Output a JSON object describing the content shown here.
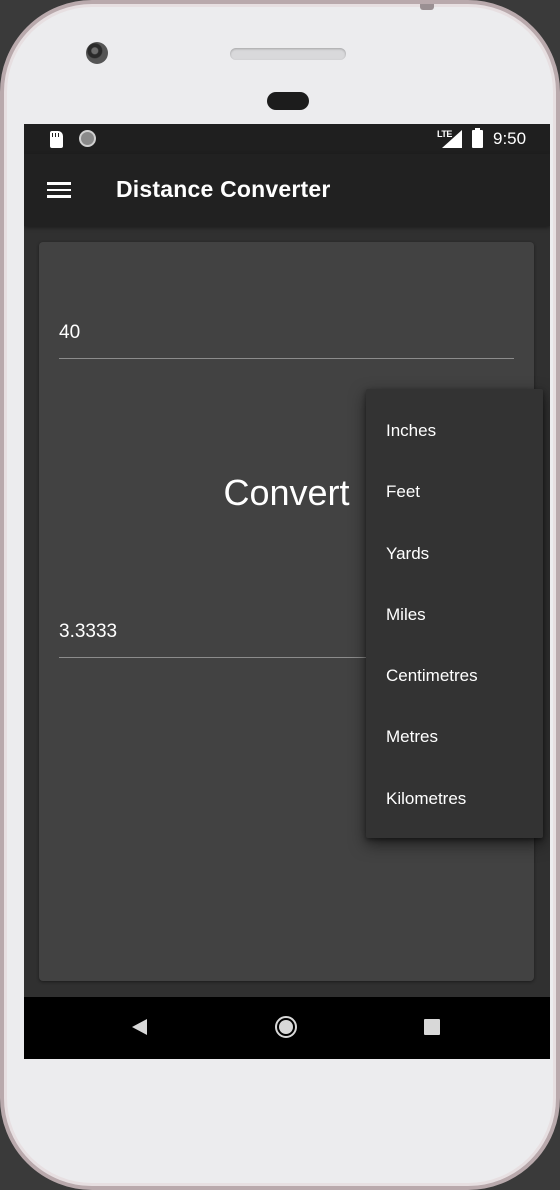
{
  "status_bar": {
    "network": "LTE",
    "time": "9:50"
  },
  "app_bar": {
    "title": "Distance Converter",
    "menu_icon": "hamburger-menu-icon"
  },
  "converter": {
    "input_value": "40",
    "convert_label": "Convert",
    "output_value": "3.3333"
  },
  "unit_menu": {
    "items": [
      "Inches",
      "Feet",
      "Yards",
      "Miles",
      "Centimetres",
      "Metres",
      "Kilometres"
    ]
  },
  "nav_bar": {
    "icons": [
      "back-icon",
      "home-icon",
      "recent-apps-icon"
    ]
  },
  "colors": {
    "background": "#303030",
    "card": "#424242",
    "app_bar": "#212121",
    "menu": "#333333",
    "text": "#ffffff"
  }
}
